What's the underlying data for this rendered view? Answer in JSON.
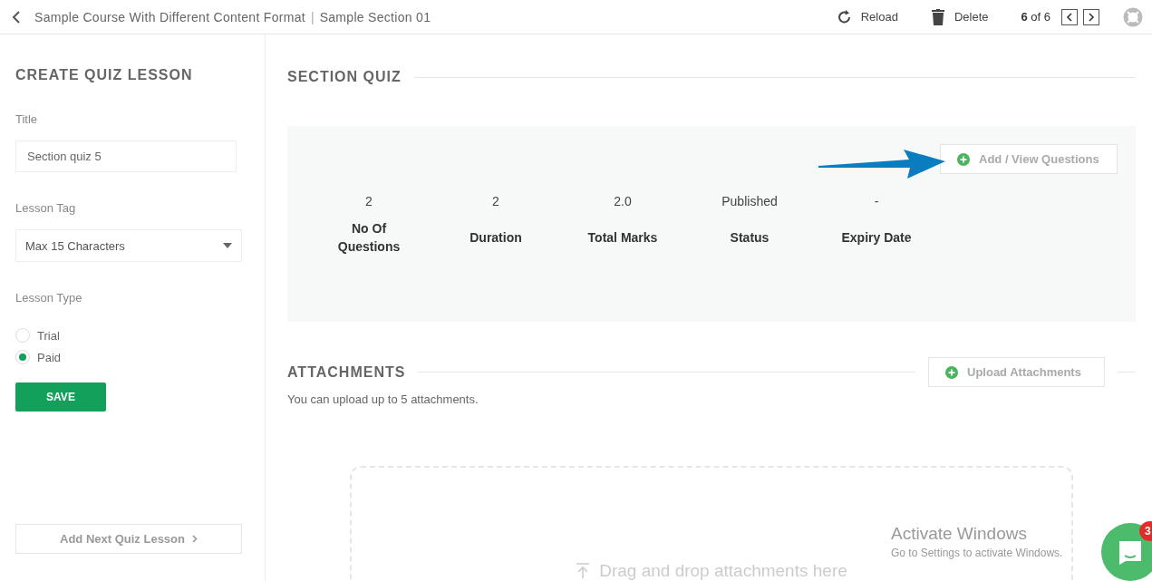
{
  "header": {
    "course": "Sample Course With Different Content Format",
    "separator": "|",
    "section": "Sample Section 01",
    "actions": [
      {
        "kind": "reload",
        "label": "Reload"
      },
      {
        "kind": "delete",
        "label": "Delete"
      }
    ],
    "pager": "**6** of 6"
  },
  "sidebar": {
    "heading": "CREATE QUIZ LESSON",
    "title_label": "Title",
    "title_value": "Section quiz 5",
    "tag_label": "Lesson Tag",
    "tag_value": "Max 15 Characters",
    "type_label": "Lesson Type",
    "types": [
      {
        "label": "Trial",
        "selected": false
      },
      {
        "label": "Paid",
        "selected": true
      }
    ],
    "save": "SAVE",
    "next": "Add Next Quiz Lesson"
  },
  "quiz": {
    "heading": "SECTION QUIZ",
    "add_button": "Add / View Questions",
    "stats": [
      {
        "value": "2",
        "label": "No Of Questions"
      },
      {
        "value": "2",
        "label": "Duration"
      },
      {
        "value": "2.0",
        "label": "Total Marks"
      },
      {
        "value": "Published",
        "label": "Status"
      },
      {
        "value": "-",
        "label": "Expiry Date"
      }
    ]
  },
  "attachments": {
    "heading": "ATTACHMENTS",
    "upload_button": "Upload Attachments",
    "note": "You can upload up to 5 attachments.",
    "drop_text": "Drag and drop attachments here"
  },
  "os_notice": {
    "title": "Activate Windows",
    "text": "Go to Settings to activate Windows."
  },
  "chat": {
    "badge": "3"
  }
}
